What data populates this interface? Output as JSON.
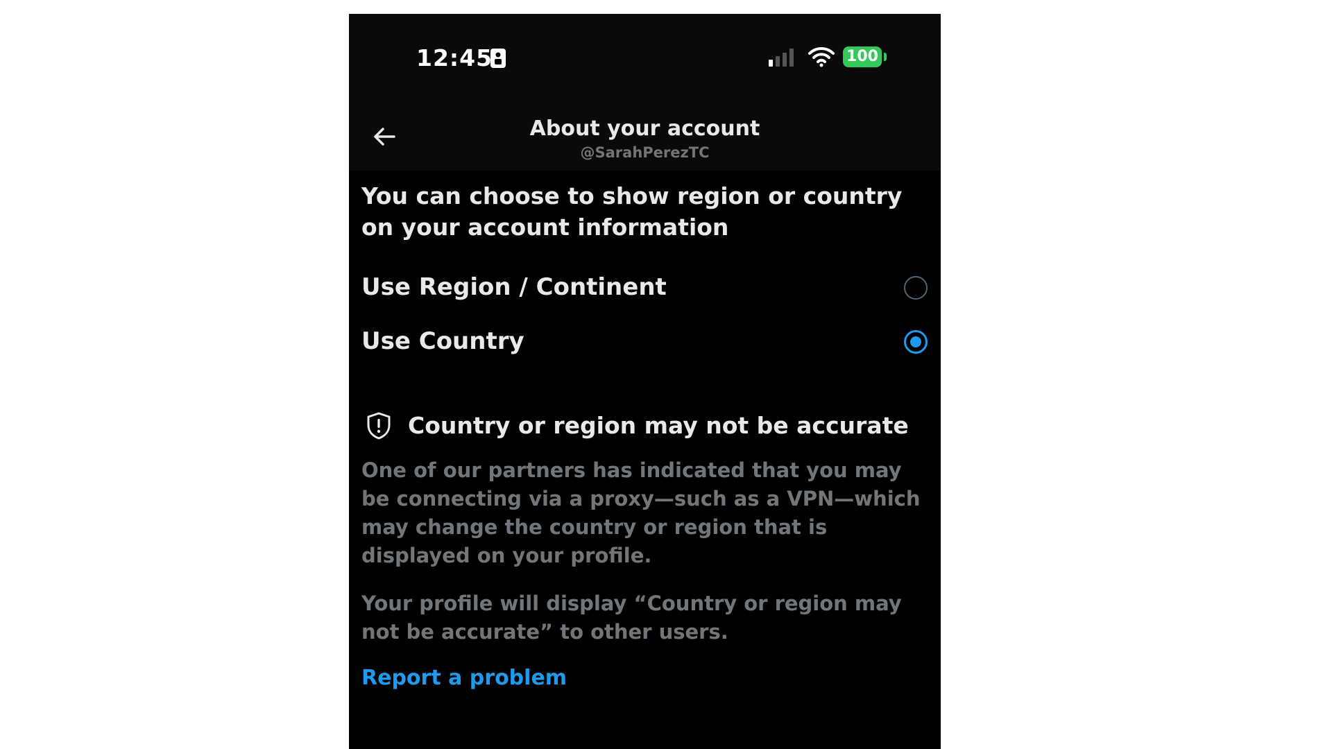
{
  "status_bar": {
    "time": "12:45",
    "battery": "100",
    "icons": [
      "id-card-icon",
      "signal-icon",
      "wifi-icon",
      "battery-icon"
    ]
  },
  "header": {
    "title": "About your account",
    "handle": "@SarahPerezTC",
    "back_icon": "back-arrow-icon"
  },
  "intro": "You can choose to show region or country on your account information",
  "options": [
    {
      "label": "Use Region / Continent",
      "selected": false
    },
    {
      "label": "Use Country",
      "selected": true
    }
  ],
  "warning": {
    "icon": "shield-alert-icon",
    "title": "Country or region may not be accurate",
    "body_1": "One of our partners has indicated that you may be connecting via a proxy—such as a VPN—which may change the country or region that is displayed on your profile.",
    "body_2": "Your profile will display “Country or region may not be accurate” to other users."
  },
  "report_link": "Report a problem",
  "colors": {
    "background": "#000000",
    "accent": "#1d9bf0",
    "battery": "#34c759",
    "primary_text": "#e7e9ea",
    "secondary_text": "#71767b"
  }
}
